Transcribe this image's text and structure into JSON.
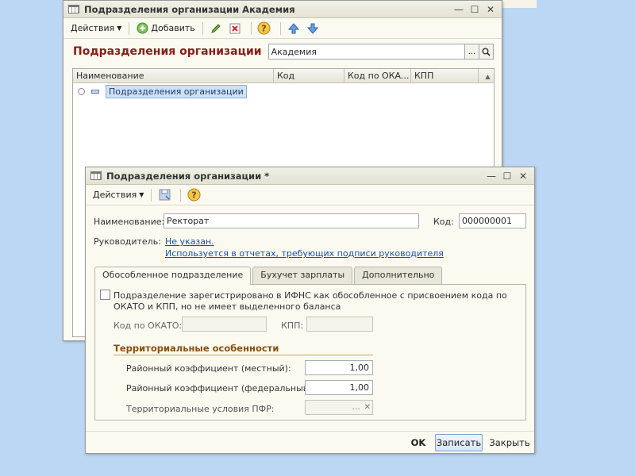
{
  "list_window": {
    "title": "Подразделения организации Академия",
    "toolbar": {
      "actions_label": "Действия",
      "add_label": "Добавить"
    },
    "heading": "Подразделения организации",
    "organization_value": "Академия",
    "columns": [
      "Наименование",
      "Код",
      "Код по ОКА...",
      "КПП"
    ],
    "rows": [
      {
        "name": "Подразделения организации"
      }
    ]
  },
  "form_window": {
    "title": "Подразделения организации *",
    "toolbar": {
      "actions_label": "Действия"
    },
    "name_label": "Наименование:",
    "name_value": "Ректорат",
    "code_label": "Код:",
    "code_value": "000000001",
    "head_label": "Руководитель:",
    "head_link": "Не указан.",
    "head_note_link": "Используется в отчетах, требующих подписи руководителя",
    "tabs": [
      "Обособленное подразделение",
      "Бухучет зарплаты",
      "Дополнительно"
    ],
    "separate_checkbox_label_1": "Подразделение зарегистрировано в ИФНС как обособленное с присвоением кода по",
    "separate_checkbox_label_2": "ОКАТО и КПП, но не имеет выделенного баланса",
    "okato_label": "Код по ОКАТО:",
    "okato_value": "",
    "kpp_label": "КПП:",
    "kpp_value": "",
    "territorial_title": "Территориальные особенности",
    "local_coef_label": "Районный коэффициент (местный):",
    "local_coef_value": "1,00",
    "federal_coef_label": "Районный коэффициент (федеральный):",
    "federal_coef_value": "1,00",
    "pfr_label": "Территориальные условия ПФР:",
    "pfr_value": "",
    "buttons": {
      "ok": "OK",
      "save": "Записать",
      "close": "Закрыть"
    }
  },
  "colors": {
    "heading": "#8a1d18",
    "section": "#8a4f0e",
    "link": "#1a4fa8",
    "background": "#bcd7f3"
  }
}
